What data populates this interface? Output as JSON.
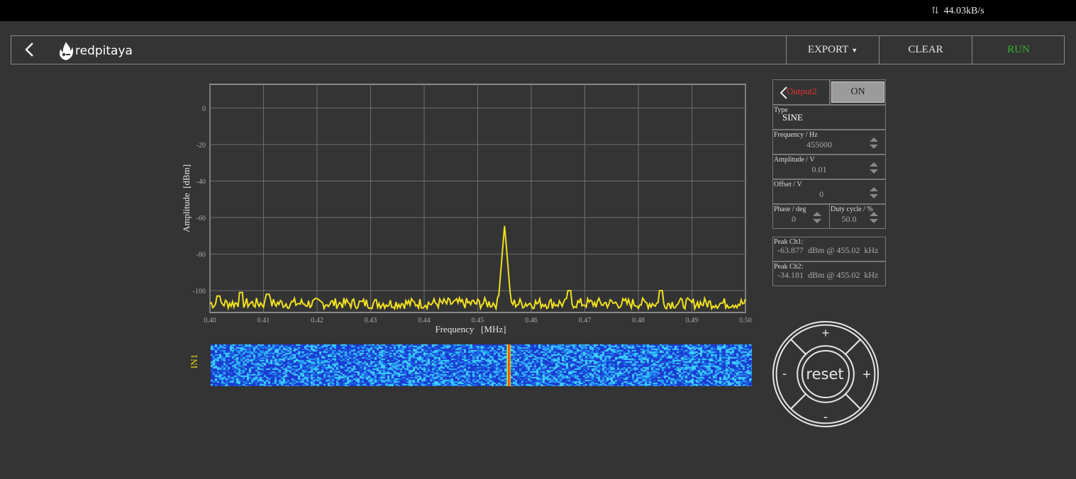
{
  "status_bar": {
    "net_speed": "44.03kB/s",
    "net_icon": "up-down-arrows-icon"
  },
  "header": {
    "back_icon": "chevron-left-icon",
    "logo_text": "redpitaya",
    "export_label": "EXPORT",
    "clear_label": "CLEAR",
    "run_label": "RUN",
    "run_color": "#2fb52f"
  },
  "chart_data": {
    "type": "line",
    "title": "",
    "xlabel": "Frequency   [MHz]",
    "ylabel": "Amplitude  [dBm]",
    "xlim": [
      0.4,
      0.5
    ],
    "ylim": [
      -112,
      13
    ],
    "x_ticks": [
      "0.40",
      "0.41",
      "0.42",
      "0.43",
      "0.44",
      "0.45",
      "0.46",
      "0.47",
      "0.48",
      "0.49",
      "0.50"
    ],
    "y_ticks": [
      "0",
      "-20",
      "-40",
      "-60",
      "-80",
      "-100"
    ],
    "grid": true,
    "series": [
      {
        "color": "#f0e020",
        "noise_floor_dBm": -107,
        "noise_span_dBm": 6,
        "peak": {
          "x": 0.45502,
          "y": -63.9
        },
        "spurs": [
          {
            "x": 0.4015,
            "y": -103
          },
          {
            "x": 0.4058,
            "y": -101
          },
          {
            "x": 0.4108,
            "y": -102
          },
          {
            "x": 0.4672,
            "y": -100
          },
          {
            "x": 0.4843,
            "y": -100
          }
        ]
      }
    ]
  },
  "waterfall": {
    "label": "IN1",
    "colormap": [
      "#1a3ad0",
      "#1f6ee8",
      "#24a0f0",
      "#3fd0ff"
    ],
    "peak_x": 0.45502
  },
  "output_panel": {
    "channel": "Output2",
    "channel_color": "#e03030",
    "toggle": "ON",
    "type_label": "Type",
    "type_value": "SINE",
    "frequency_label": "Frequency   / Hz",
    "frequency_value": "455000",
    "amplitude_label": "Amplitude  / V",
    "amplitude_value": "0.01",
    "offset_label": "Offset  / V",
    "offset_value": "0",
    "phase_label": "Phase   / deg",
    "phase_value": "0",
    "duty_label": "Duty cycle  / %",
    "duty_value": "50.0"
  },
  "peaks": {
    "ch1_label": "Peak  Ch1:",
    "ch1_value": "-63.877  dBm @ 455.02  kHz",
    "ch2_label": "Peak  Ch2:",
    "ch2_value": "-34.181  dBm @ 455.02  kHz"
  },
  "dpad": {
    "reset_label": "reset",
    "plus": "+",
    "minus": "-"
  }
}
